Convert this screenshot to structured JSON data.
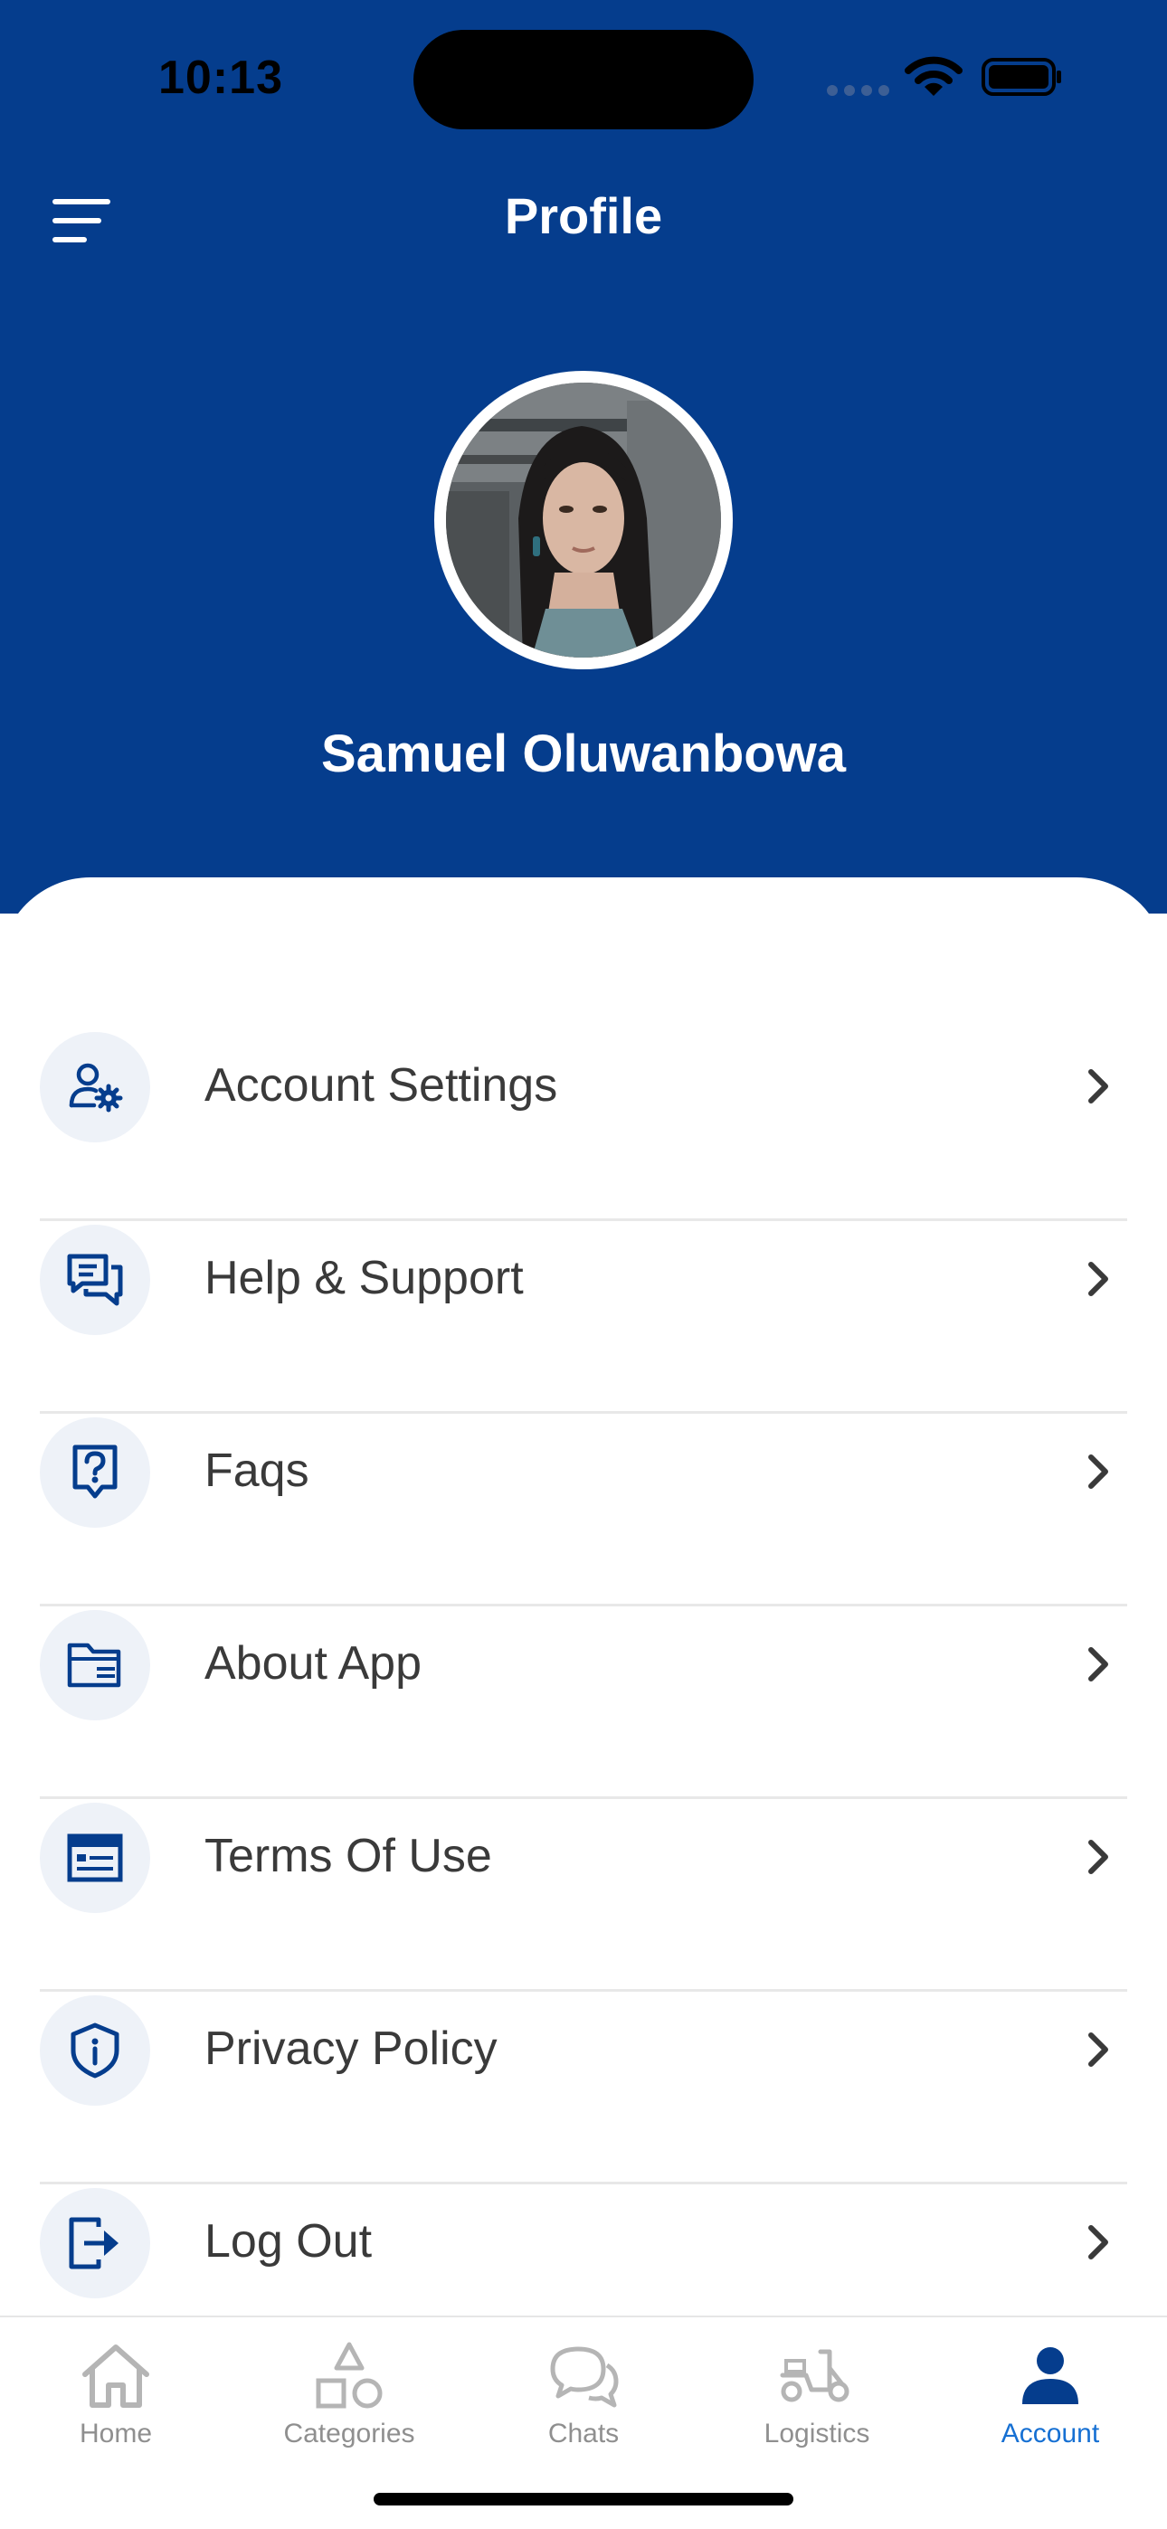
{
  "status_bar": {
    "time": "10:13"
  },
  "header": {
    "title": "Profile"
  },
  "profile": {
    "name": "Samuel Oluwanbowa"
  },
  "menu": [
    {
      "label": "Account Settings",
      "icon": "user-gear-icon"
    },
    {
      "label": "Help & Support",
      "icon": "chat-bubbles-icon"
    },
    {
      "label": "Faqs",
      "icon": "question-icon"
    },
    {
      "label": "About App",
      "icon": "folder-icon"
    },
    {
      "label": "Terms Of Use",
      "icon": "browser-window-icon"
    },
    {
      "label": "Privacy Policy",
      "icon": "shield-info-icon"
    },
    {
      "label": "Log Out",
      "icon": "logout-icon"
    }
  ],
  "tabs": [
    {
      "label": "Home",
      "icon": "home-icon",
      "active": false
    },
    {
      "label": "Categories",
      "icon": "shapes-icon",
      "active": false
    },
    {
      "label": "Chats",
      "icon": "chats-icon",
      "active": false
    },
    {
      "label": "Logistics",
      "icon": "scooter-icon",
      "active": false
    },
    {
      "label": "Account",
      "icon": "person-icon",
      "active": true
    }
  ],
  "colors": {
    "brand": "#053d8d",
    "active_tab": "#1670d3",
    "inactive_tab": "#8f8f8f",
    "icon_bg": "#eef2f8"
  }
}
